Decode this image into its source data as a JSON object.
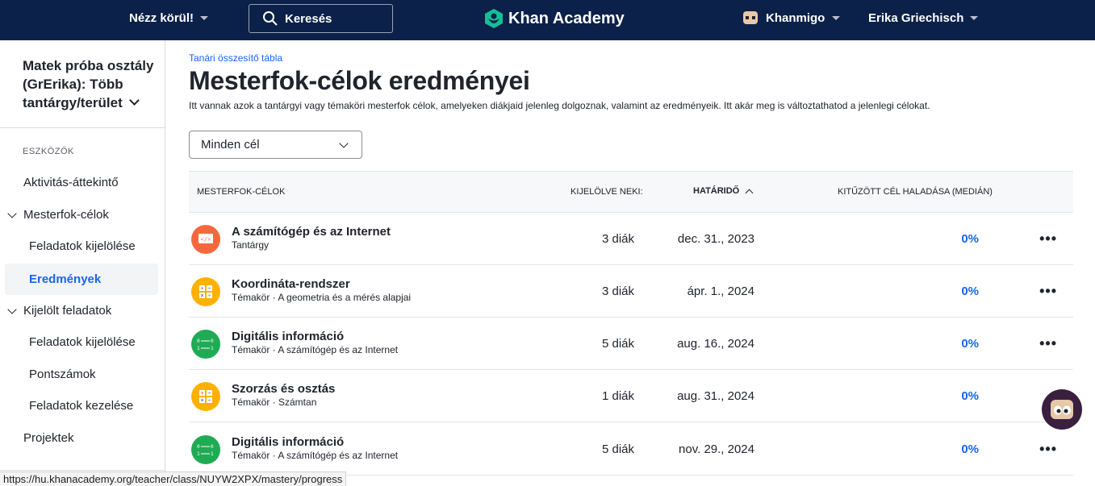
{
  "nav": {
    "explore_label": "Nézz körül!",
    "search_placeholder": "Keresés",
    "brand": "Khan Academy",
    "khanmigo_label": "Khanmigo",
    "user_name": "Erika Griechisch"
  },
  "sidebar": {
    "class_title": "Matek próba osztály (GrErika): Több tantárgy/terület",
    "section_label": "ESZKÖZÖK",
    "items": [
      {
        "label": "Aktivitás-áttekintő"
      },
      {
        "label": "Mesterfok-célok"
      },
      {
        "label": "Feladatok kijelölése"
      },
      {
        "label": "Eredmények"
      },
      {
        "label": "Kijelölt feladatok"
      },
      {
        "label": "Feladatok kijelölése"
      },
      {
        "label": "Pontszámok"
      },
      {
        "label": "Feladatok kezelése"
      },
      {
        "label": "Projektek"
      }
    ]
  },
  "main": {
    "breadcrumb": "Tanári összesítő tábla",
    "title": "Mesterfok-célok eredményei",
    "description": "Itt vannak azok a tantárgyi vagy témaköri mesterfok célok, amelyeken diákjaid jelenleg dolgoznak, valamint az eredményeik. Itt akár meg is változtathatod a jelenlegi célokat.",
    "filter_value": "Minden cél",
    "table": {
      "headers": {
        "goals": "MESTERFOK-CÉLOK",
        "assigned": "KIJELÖLVE NEKI:",
        "due": "HATÁRIDŐ",
        "progress": "KITŰZÖTT CÉL HALADÁSA (MEDIÁN)"
      },
      "rows": [
        {
          "title": "A számítógép és az Internet",
          "subtitle": "Tantárgy",
          "assigned": "3 diák",
          "due": "dec. 31., 2023",
          "progress": "0%",
          "icon": "computer-icon",
          "icon_color": "#f5683d"
        },
        {
          "title": "Koordináta-rendszer",
          "subtitle": "Témakör · A geometria és a mérés alapjai",
          "assigned": "3 diák",
          "due": "ápr. 1., 2024",
          "progress": "0%",
          "icon": "math-icon",
          "icon_color": "#ffb100"
        },
        {
          "title": "Digitális információ",
          "subtitle": "Témakör · A számítógép és az Internet",
          "assigned": "5 diák",
          "due": "aug. 16., 2024",
          "progress": "0%",
          "icon": "binary-icon",
          "icon_color": "#1fab54"
        },
        {
          "title": "Szorzás és osztás",
          "subtitle": "Témakör · Számtan",
          "assigned": "1 diák",
          "due": "aug. 31., 2024",
          "progress": "0%",
          "icon": "math-icon",
          "icon_color": "#ffb100"
        },
        {
          "title": "Digitális információ",
          "subtitle": "Témakör · A számítógép és az Internet",
          "assigned": "5 diák",
          "due": "nov. 29., 2024",
          "progress": "0%",
          "icon": "binary-icon",
          "icon_color": "#1fab54"
        }
      ]
    }
  },
  "status_bar": {
    "url": "https://hu.khanacademy.org/teacher/class/NUYW2XPX/mastery/progress"
  },
  "colors": {
    "nav_bg": "#0b2149",
    "link_blue": "#1865f2"
  }
}
